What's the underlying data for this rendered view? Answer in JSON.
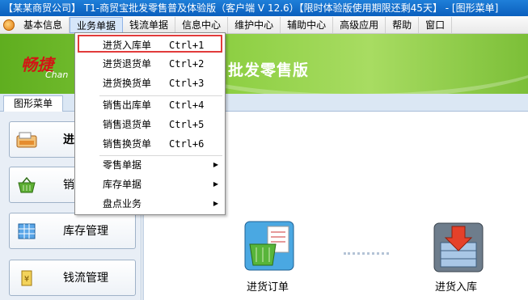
{
  "window": {
    "title": "【某某商贸公司】 T1-商贸宝批发零售普及体验版（客户端 V 12.6）【限时体验版使用期限还剩45天】 - [图形菜单]"
  },
  "menubar": {
    "items": [
      "基本信息",
      "业务单据",
      "钱流单据",
      "信息中心",
      "维护中心",
      "辅助中心",
      "高级应用",
      "帮助",
      "窗口"
    ],
    "active_index": 1
  },
  "banner": {
    "logo_cn": "畅捷",
    "logo_en": "Chan",
    "slogan": "批发零售版"
  },
  "tabs": {
    "graphic_menu": "图形菜单"
  },
  "left_nav": {
    "items": [
      {
        "label": "进",
        "icon": "purchase-register-icon"
      },
      {
        "label": "销",
        "icon": "sales-basket-icon"
      },
      {
        "label": "库存管理",
        "icon": "inventory-grid-icon"
      },
      {
        "label": "钱流管理",
        "icon": "cash-icon"
      }
    ]
  },
  "workarea": {
    "items": [
      {
        "label": "进货订单",
        "icon": "purchase-order-icon"
      },
      {
        "label": "进货入库",
        "icon": "purchase-stockin-icon"
      }
    ]
  },
  "dropdown": {
    "items": [
      {
        "label": "进货入库单",
        "shortcut": "Ctrl+1",
        "highlighted": true
      },
      {
        "label": "进货退货单",
        "shortcut": "Ctrl+2"
      },
      {
        "label": "进货换货单",
        "shortcut": "Ctrl+3"
      },
      {
        "label": "销售出库单",
        "shortcut": "Ctrl+4"
      },
      {
        "label": "销售退货单",
        "shortcut": "Ctrl+5"
      },
      {
        "label": "销售换货单",
        "shortcut": "Ctrl+6"
      },
      {
        "label": "零售单据",
        "submenu": true
      },
      {
        "label": "库存单据",
        "submenu": true
      },
      {
        "label": "盘点业务",
        "submenu": true
      }
    ]
  },
  "colors": {
    "highlight_border": "#e23b3b",
    "banner_green": "#8fd045",
    "logo_red": "#d21515"
  }
}
